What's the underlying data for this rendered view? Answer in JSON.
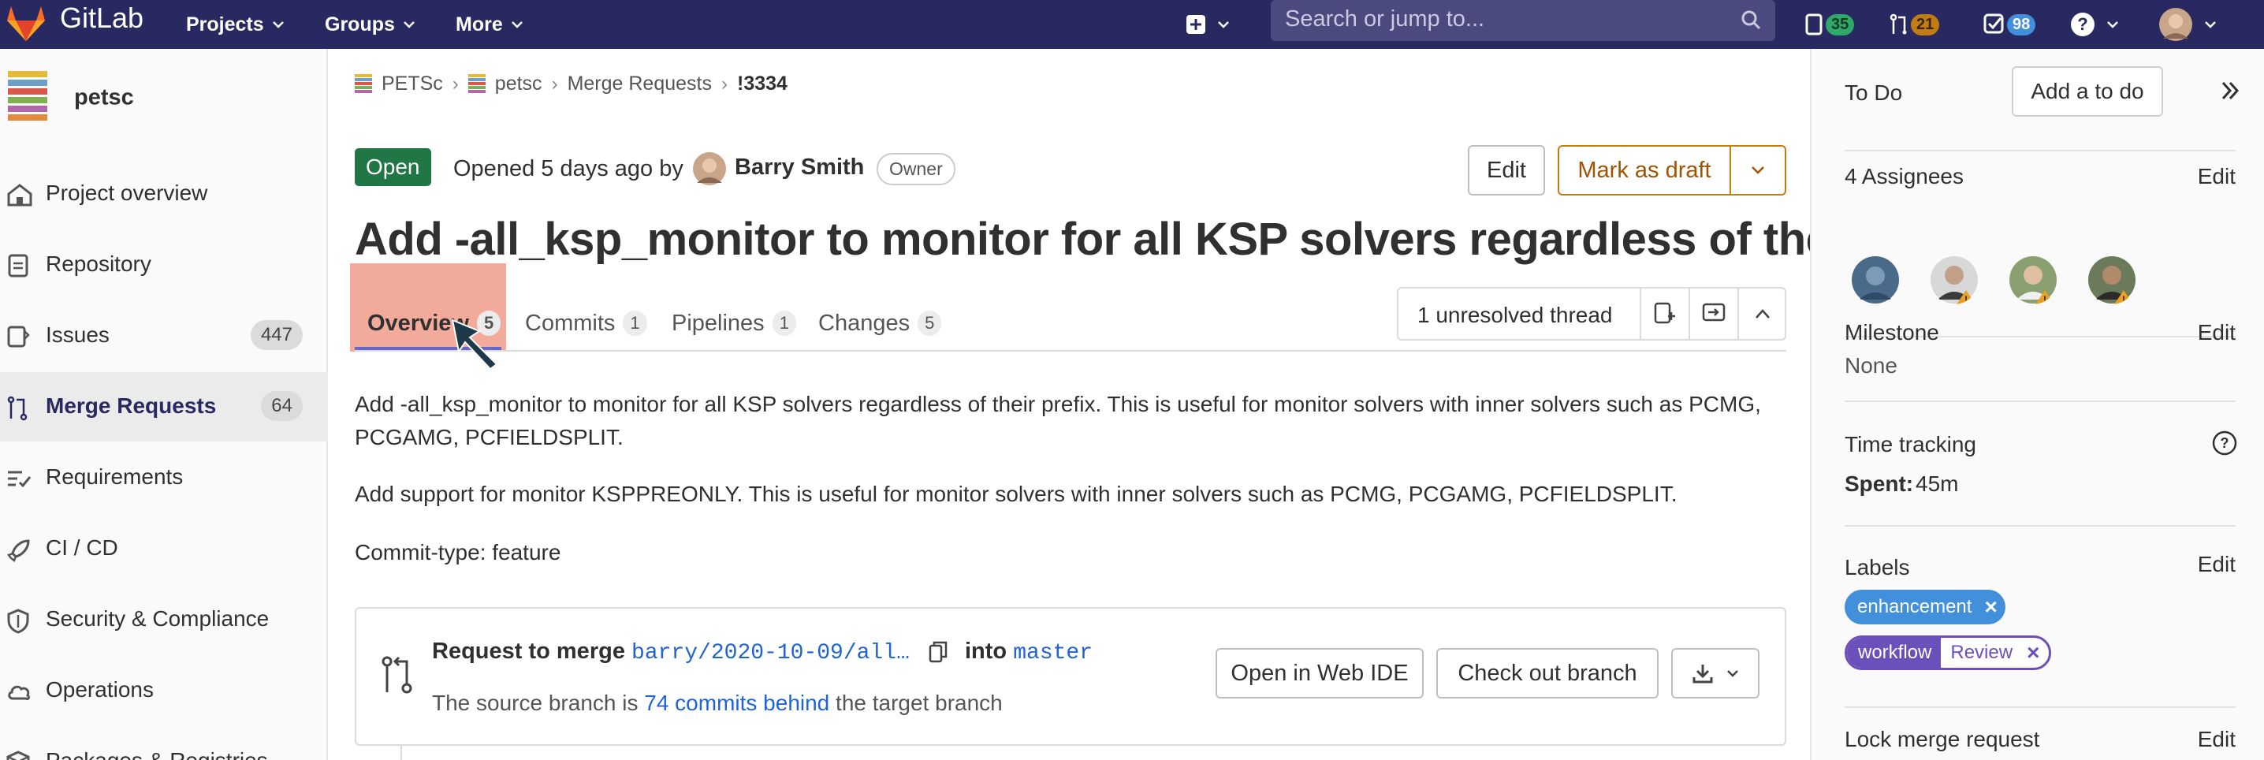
{
  "app": {
    "brand": "GitLab"
  },
  "topnav": {
    "items": [
      {
        "label": "Projects"
      },
      {
        "label": "Groups"
      },
      {
        "label": "More"
      }
    ],
    "search_placeholder": "Search or jump to...",
    "issues_count": "35",
    "mr_count": "21",
    "todo_count": "98",
    "colors": {
      "bar": "#292961",
      "issues_badge": "#2fa86a",
      "mr_badge": "#c17d10",
      "todo_badge": "#428fdc"
    }
  },
  "sidebar": {
    "project_name": "petsc",
    "items": [
      {
        "label": "Project overview",
        "icon": "home-icon"
      },
      {
        "label": "Repository",
        "icon": "document-icon"
      },
      {
        "label": "Issues",
        "icon": "issues-icon",
        "badge": "447"
      },
      {
        "label": "Merge Requests",
        "icon": "merge-request-icon",
        "badge": "64",
        "active": true
      },
      {
        "label": "Requirements",
        "icon": "requirements-icon"
      },
      {
        "label": "CI / CD",
        "icon": "rocket-icon"
      },
      {
        "label": "Security & Compliance",
        "icon": "shield-icon"
      },
      {
        "label": "Operations",
        "icon": "cloud-icon"
      },
      {
        "label": "Packages & Registries",
        "icon": "package-icon"
      }
    ]
  },
  "breadcrumb": [
    "PETSc",
    "petsc",
    "Merge Requests",
    "!3334"
  ],
  "mr": {
    "status": "Open",
    "opened_text": "Opened 5 days ago by",
    "author": "Barry Smith",
    "author_role": "Owner",
    "edit_label": "Edit",
    "draft_label": "Mark as draft",
    "title": "Add -all_ksp_monitor to monitor for all KSP solvers regardless of their...",
    "tabs": [
      {
        "label": "Overview",
        "count": "5",
        "active": true
      },
      {
        "label": "Commits",
        "count": "1"
      },
      {
        "label": "Pipelines",
        "count": "1"
      },
      {
        "label": "Changes",
        "count": "5"
      }
    ],
    "unresolved_thread": "1 unresolved thread",
    "description": [
      "Add -all_ksp_monitor to monitor for all KSP solvers regardless of their prefix. This is useful for monitor solvers with inner solvers such as PCMG, PCGAMG, PCFIELDSPLIT.",
      "Add support for monitor KSPPREONLY. This is useful for monitor solvers with inner solvers such as PCMG, PCGAMG, PCFIELDSPLIT.",
      "Commit-type: feature"
    ],
    "merge": {
      "request_label": "Request to merge",
      "source_branch": "barry/2020-10-09/all…",
      "into_label": "into",
      "target_branch": "master",
      "source_text_before": "The source branch is",
      "commits_behind": "74 commits behind",
      "source_text_after": "the target branch",
      "web_ide_label": "Open in Web IDE",
      "checkout_label": "Check out branch"
    }
  },
  "right_sidebar": {
    "todo_label": "To Do",
    "add_todo_label": "Add a to do",
    "assignees_label": "4 Assignees",
    "edit_label": "Edit",
    "milestone_label": "Milestone",
    "milestone_value": "None",
    "time_tracking_label": "Time tracking",
    "spent_label": "Spent:",
    "spent_value": "45m",
    "labels_label": "Labels",
    "labels": [
      {
        "text": "enhancement",
        "color": "#428fdc"
      },
      {
        "scope": "workflow",
        "value": "Review",
        "color": "#6b4fbb"
      }
    ],
    "lock_label": "Lock merge request"
  }
}
